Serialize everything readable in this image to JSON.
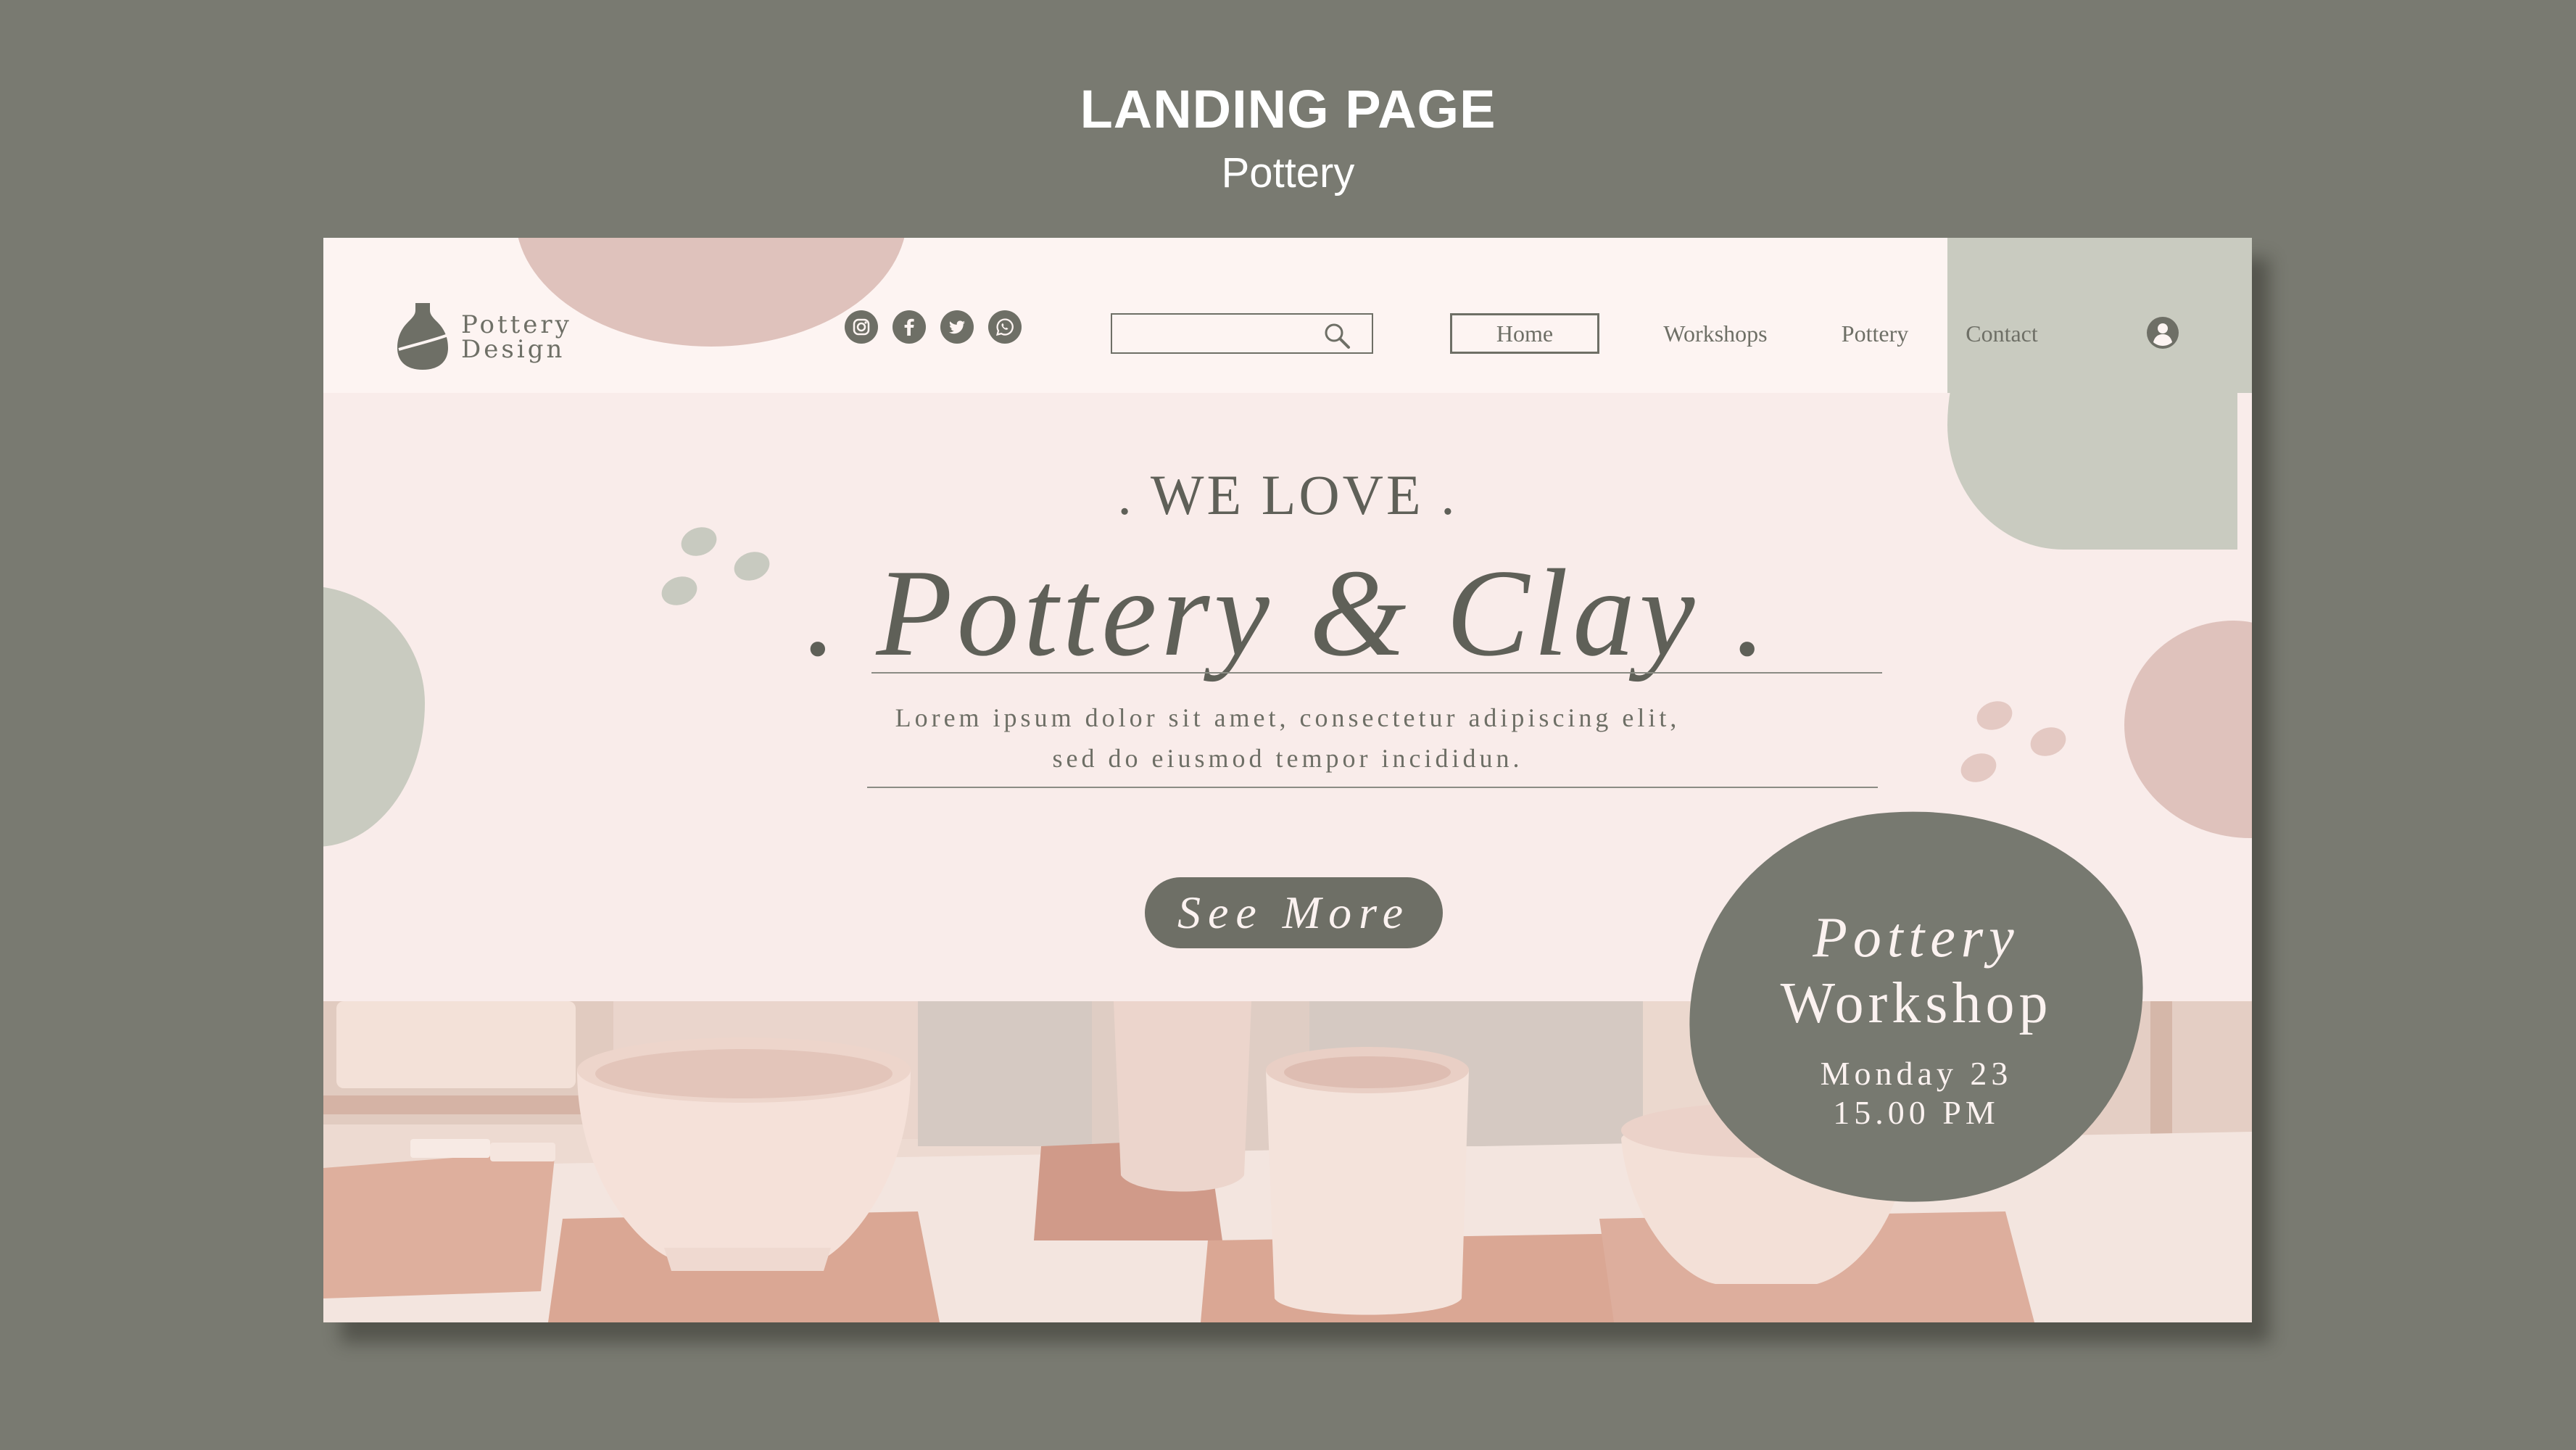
{
  "frame": {
    "title": "LANDING PAGE",
    "subtitle": "Pottery"
  },
  "header": {
    "logo": {
      "line1": "Pottery",
      "line2": "Design",
      "icon": "vase-icon"
    },
    "social": [
      "instagram-icon",
      "facebook-icon",
      "twitter-icon",
      "whatsapp-icon"
    ],
    "search": {
      "value": "",
      "placeholder": "",
      "icon": "search-icon"
    },
    "nav": {
      "home": "Home",
      "workshops": "Workshops",
      "pottery": "Pottery",
      "contact": "Contact",
      "active": "Home"
    },
    "user_icon": "user-icon"
  },
  "hero": {
    "kicker": ". WE LOVE .",
    "title": ". Pottery & Clay .",
    "text_line1": "Lorem ipsum dolor sit amet, consectetur adipiscing elit,",
    "text_line2": "sed do eiusmod tempor incididun.",
    "button": "See More"
  },
  "workshop": {
    "title_line1": "Pottery",
    "title_line2": "Workshop",
    "date": "Monday 23",
    "time": "15.00 PM"
  },
  "colors": {
    "frame_background": "#797a71",
    "page_background": "#f9ecea",
    "header_background": "#fdf4f2",
    "accent_dark": "#6e6f66",
    "accent_pink": "#dfc2bc",
    "accent_sage": "#c9cbc0"
  }
}
